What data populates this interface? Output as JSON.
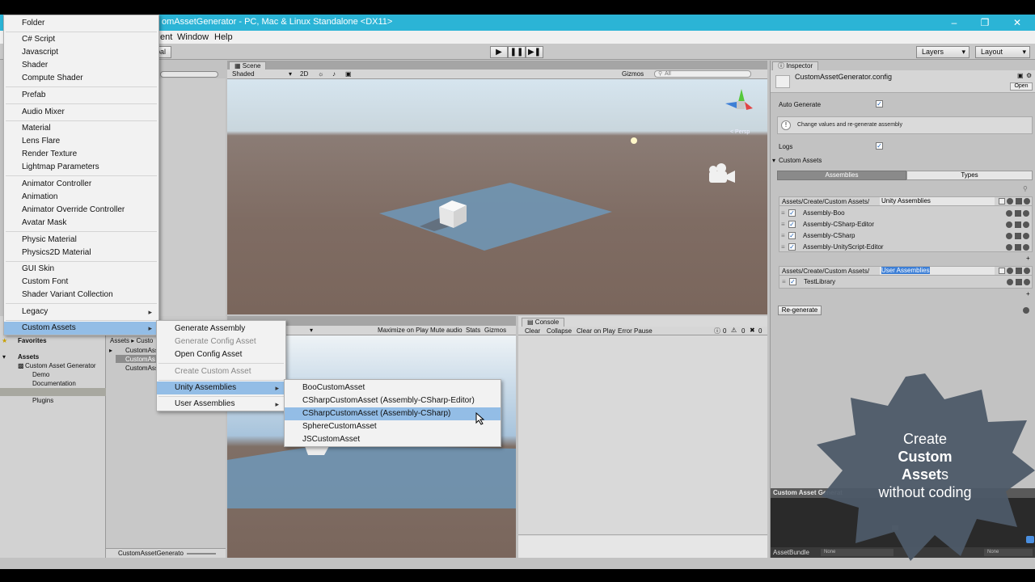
{
  "window": {
    "title": "omAssetGenerator - PC, Mac & Linux Standalone <DX11>",
    "menu": [
      "ent",
      "Window",
      "Help"
    ],
    "toolbar_left": "bal",
    "layers": "Layers",
    "layout": "Layout"
  },
  "scene": {
    "tab": "Scene",
    "shading": "Shaded",
    "mode2d": "2D",
    "gizmos": "Gizmos",
    "search": "All",
    "persp": "< Persp"
  },
  "game": {
    "buttons": [
      "Maximize on Play",
      "Mute audio",
      "Stats",
      "Gizmos"
    ]
  },
  "console": {
    "tab": "Console",
    "buttons": [
      "Clear",
      "Collapse",
      "Clear on Play",
      "Error Pause"
    ],
    "counts": [
      "0",
      "0",
      "0"
    ]
  },
  "create_menu": {
    "groups": [
      [
        "Folder"
      ],
      [
        "C# Script",
        "Javascript",
        "Shader",
        "Compute Shader"
      ],
      [
        "Prefab"
      ],
      [
        "Audio Mixer"
      ],
      [
        "Material",
        "Lens Flare",
        "Render Texture",
        "Lightmap Parameters"
      ],
      [
        "Animator Controller",
        "Animation",
        "Animator Override Controller",
        "Avatar Mask"
      ],
      [
        "Physic Material",
        "Physics2D Material"
      ],
      [
        "GUI Skin",
        "Custom Font",
        "Shader Variant Collection"
      ],
      [
        "Legacy"
      ],
      [
        "Custom Assets"
      ]
    ]
  },
  "custom_assets_menu": {
    "items": [
      "Generate Assembly",
      "Generate Config Asset",
      "Open Config Asset",
      "Create Custom Asset",
      "Unity Assemblies",
      "User Assemblies"
    ]
  },
  "unity_assemblies_menu": {
    "items": [
      "BooCustomAsset",
      "CSharpCustomAsset (Assembly-CSharp-Editor)",
      "CSharpCustomAsset (Assembly-CSharp)",
      "SphereCustomAsset",
      "JSCustomAsset"
    ]
  },
  "project": {
    "favorites": "Favorites",
    "assets": "Assets",
    "tree": [
      "Custom Asset Generator",
      "Demo",
      "Documentation",
      "Plugins"
    ],
    "breadcrumb": "Assets ▸ Custo",
    "files": [
      "CustomAss",
      "CustomAs",
      "CustomAss"
    ],
    "status": "CustomAssetGenerato"
  },
  "inspector": {
    "tab": "Inspector",
    "asset_name": "CustomAssetGenerator.config",
    "open": "Open",
    "auto_generate": "Auto Generate",
    "info": "Change values and re-generate assembly",
    "logs": "Logs",
    "custom_assets": "Custom Assets",
    "tabs": [
      "Assemblies",
      "Types"
    ],
    "list1_path": "Assets/Create/Custom Assets/",
    "list1_name": "Unity Assemblies",
    "list1_items": [
      "Assembly-Boo",
      "Assembly-CSharp-Editor",
      "Assembly-CSharp",
      "Assembly-UnityScript-Editor"
    ],
    "list2_path": "Assets/Create/Custom Assets/",
    "list2_name": "User Assemblies",
    "list2_items": [
      "TestLibrary"
    ],
    "regenerate": "Re-generate",
    "preview_title": "Custom Asset Generat",
    "assetbundle": "AssetBundle",
    "none1": "None",
    "none2": "None"
  },
  "badge": {
    "line1": "Create",
    "line2": "Custom",
    "line3a": "Asset",
    "line3b": "s",
    "line4": "without coding"
  }
}
